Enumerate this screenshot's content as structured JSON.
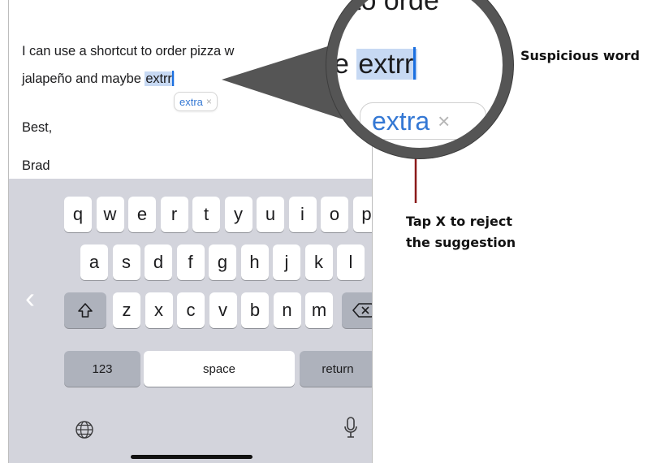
{
  "note": {
    "line1": "I can use a shortcut to order pizza w",
    "line2_prefix": "jalapeño and maybe ",
    "misspelled_word": "extrr",
    "suggestion": "extra",
    "suggestion_dismiss": "×",
    "line3": "Best,",
    "line4": "Brad"
  },
  "keyboard": {
    "row1": [
      "q",
      "w",
      "e",
      "r",
      "t",
      "y",
      "u",
      "i",
      "o",
      "p"
    ],
    "row2": [
      "a",
      "s",
      "d",
      "f",
      "g",
      "h",
      "j",
      "k",
      "l"
    ],
    "row3": [
      "z",
      "x",
      "c",
      "v",
      "b",
      "n",
      "m"
    ],
    "numbers_key": "123",
    "space_key": "space",
    "return_key": "return",
    "shift_icon": "shift-icon",
    "delete_icon": "delete-icon",
    "globe_icon": "globe-icon",
    "mic_icon": "microphone-icon",
    "chevron_icon": "chevron-left-icon"
  },
  "magnifier": {
    "line1": "to orde",
    "line2_prefix": "e ",
    "misspelled_word": "extrr",
    "suggestion": "extra",
    "suggestion_dismiss": "×"
  },
  "callouts": {
    "suspicious": "Suspicious word",
    "reject_line1": "Tap X to reject",
    "reject_line2": "the suggestion"
  },
  "colors": {
    "selection": "#c7d9f3",
    "caret": "#1a6fe0",
    "suggestion_text": "#3478d4",
    "keyboard_bg": "#d3d4dc",
    "callout_line": "#8b1a1a",
    "magnifier_ring": "#555555"
  }
}
